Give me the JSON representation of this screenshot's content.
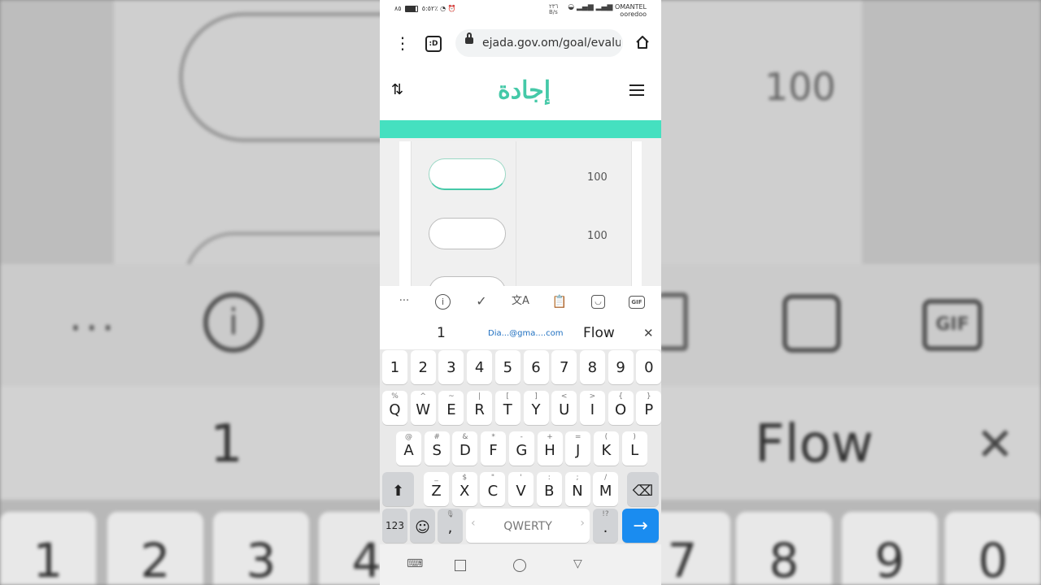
{
  "status_bar": {
    "time": "٥:٥٢",
    "net_speed_value": "٢٣٦",
    "net_speed_unit": "B/s",
    "battery": "٨٥٪",
    "carrier1": "OMANTEL",
    "carrier2": "ooredoo"
  },
  "browser": {
    "tabs_glyph": ":D",
    "url": "ejada.gov.om/goal/evalu"
  },
  "site": {
    "logo_text": "إجادة",
    "accent_color": "#45c9a8",
    "bar_color": "#45e0c0"
  },
  "table": {
    "rows": [
      {
        "value": "100"
      },
      {
        "value": "100"
      }
    ]
  },
  "keyboard": {
    "toolbar_icons": [
      "more-icon",
      "info-icon",
      "grammar-check-icon",
      "translate-icon",
      "clipboard-icon",
      "sticker-icon",
      "gif-icon"
    ],
    "toolbar": {
      "more": "···",
      "info": "i",
      "gif": "GIF"
    },
    "suggestions": {
      "first": "1",
      "email": "Dia...@gma....com",
      "third": "Flow"
    },
    "number_row": [
      "1",
      "2",
      "3",
      "4",
      "5",
      "6",
      "7",
      "8",
      "9",
      "0"
    ],
    "row1": [
      {
        "main": "Q",
        "sup": "%"
      },
      {
        "main": "W",
        "sup": "^"
      },
      {
        "main": "E",
        "sup": "~"
      },
      {
        "main": "R",
        "sup": "|"
      },
      {
        "main": "T",
        "sup": "["
      },
      {
        "main": "Y",
        "sup": "]"
      },
      {
        "main": "U",
        "sup": "<"
      },
      {
        "main": "I",
        "sup": ">"
      },
      {
        "main": "O",
        "sup": "{"
      },
      {
        "main": "P",
        "sup": "}"
      }
    ],
    "row2": [
      {
        "main": "A",
        "sup": "@"
      },
      {
        "main": "S",
        "sup": "#"
      },
      {
        "main": "D",
        "sup": "&"
      },
      {
        "main": "F",
        "sup": "*"
      },
      {
        "main": "G",
        "sup": "-"
      },
      {
        "main": "H",
        "sup": "+"
      },
      {
        "main": "J",
        "sup": "="
      },
      {
        "main": "K",
        "sup": "("
      },
      {
        "main": "L",
        "sup": ")"
      }
    ],
    "row3": [
      {
        "main": "Z",
        "sup": "_"
      },
      {
        "main": "X",
        "sup": "$"
      },
      {
        "main": "C",
        "sup": "\""
      },
      {
        "main": "V",
        "sup": "'"
      },
      {
        "main": "B",
        "sup": ":"
      },
      {
        "main": "N",
        "sup": ";"
      },
      {
        "main": "M",
        "sup": "/"
      }
    ],
    "numeric_label": "123",
    "comma": ",",
    "space_label": "QWERTY",
    "period": ".",
    "period_sup": "!?"
  },
  "background": {
    "value": "100",
    "suggest_first": "1",
    "suggest_third": "Flow",
    "keys": [
      "1",
      "2",
      "3",
      "4",
      "7",
      "8",
      "9",
      "0"
    ]
  }
}
